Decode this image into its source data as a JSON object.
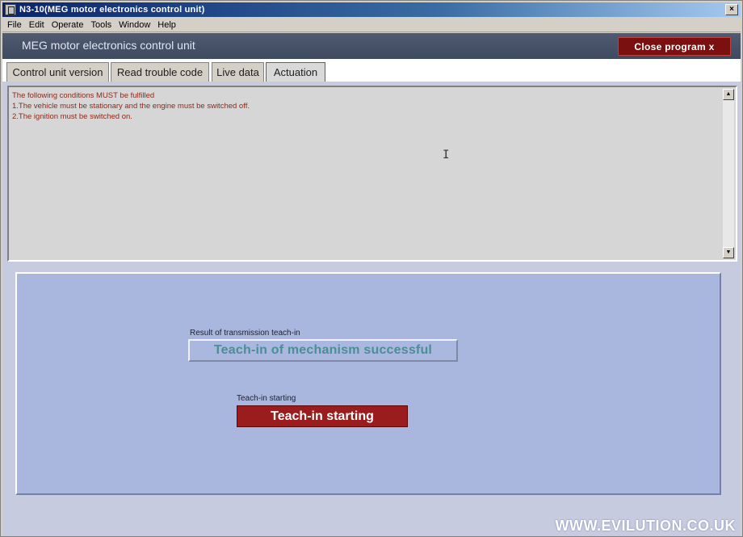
{
  "window": {
    "title": "N3-10(MEG motor electronics control unit)",
    "close_glyph": "×"
  },
  "menu": [
    "File",
    "Edit",
    "Operate",
    "Tools",
    "Window",
    "Help"
  ],
  "header": {
    "title": "MEG   motor electronics control unit",
    "close_button": "Close program x"
  },
  "tabs": [
    {
      "label": "Control unit version",
      "active": false
    },
    {
      "label": "Read trouble code",
      "active": false
    },
    {
      "label": "Live data",
      "active": false
    },
    {
      "label": "Actuation",
      "active": true
    }
  ],
  "conditions": {
    "lines": [
      "The following conditions MUST be fulfilled",
      "1.The vehicle must be stationary and the engine must be switched off.",
      "2.The ignition must be switched on."
    ]
  },
  "result": {
    "label": "Result of transmission teach-in",
    "value": "Teach-in of mechanism successful"
  },
  "teachin": {
    "label": "Teach-in starting",
    "button": "Teach-in starting"
  },
  "watermark": "WWW.EVILUTION.CO.UK",
  "colors": {
    "accent_red": "#9a1c1c",
    "panel_blue": "#a9b6de",
    "result_teal": "#4a8e96"
  }
}
